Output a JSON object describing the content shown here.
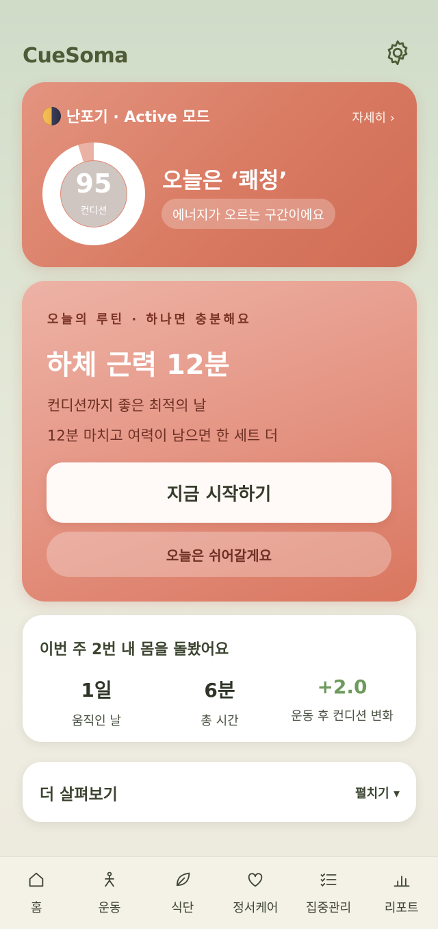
{
  "header": {
    "app_title": "CueSoma",
    "settings_icon": "gear-icon"
  },
  "cycle_card": {
    "phase_icon": "moon-phase-icon",
    "phase_label": "난포기 · Active 모드",
    "detail_link": "자세히 ›",
    "condition_score": "95",
    "condition_score_fraction": 0.95,
    "condition_label": "컨디션",
    "mood_title": "오늘은 ‘쾌청’",
    "mood_pill": "에너지가 오르는 구간이에요"
  },
  "routine_card": {
    "kicker": "오늘의 루틴 · 하나면 충분해요",
    "title": "하체 근력 12분",
    "desc_line1": "컨디션까지 좋은 최적의 날",
    "desc_line2": "12분 마치고 여력이 남으면 한 세트 더",
    "start_label": "지금 시작하기",
    "rest_label": "오늘은 쉬어갈게요"
  },
  "week_card": {
    "title": "이번 주 2번 내 몸을 돌봤어요",
    "stats": [
      {
        "value": "1일",
        "label": "움직인 날"
      },
      {
        "value": "6분",
        "label": "총 시간"
      },
      {
        "value": "+2.0",
        "label": "운동 후 컨디션 변화"
      }
    ]
  },
  "more_card": {
    "title": "더 살펴보기",
    "toggle": "펼치기 ▾"
  },
  "nav": {
    "items": [
      {
        "label": "홈",
        "icon": "home-icon"
      },
      {
        "label": "운동",
        "icon": "exercise-icon"
      },
      {
        "label": "식단",
        "icon": "leaf-icon"
      },
      {
        "label": "정서케어",
        "icon": "heart-icon"
      },
      {
        "label": "집중관리",
        "icon": "checklist-icon"
      },
      {
        "label": "리포트",
        "icon": "bar-chart-icon"
      }
    ]
  },
  "colors": {
    "brand": "#4f5a36",
    "accent_coral": "#d97a62",
    "positive_green": "#6e9a5d"
  }
}
